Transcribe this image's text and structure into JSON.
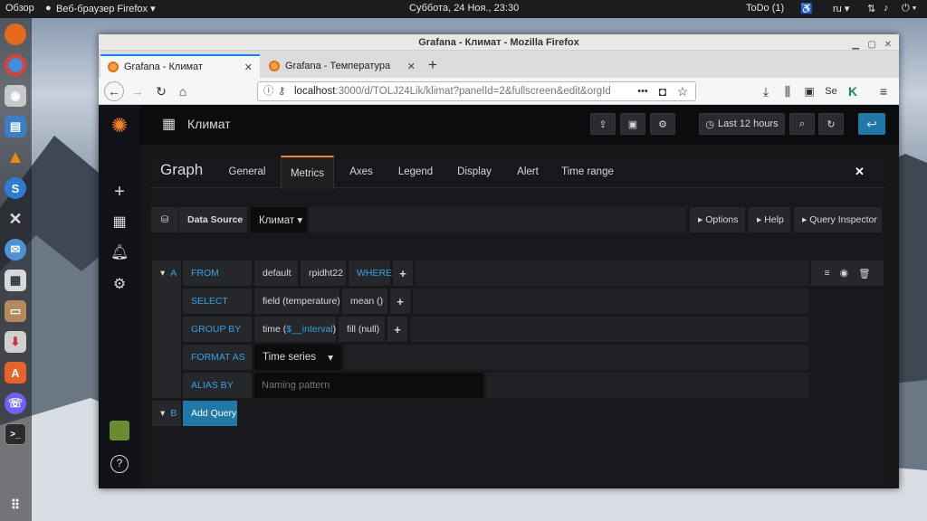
{
  "desktop": {
    "activities": "Обзор",
    "browser_menu": "Веб-браузер Firefox ▾",
    "clock": "Суббота, 24 Ноя., 23:30",
    "todo": "ToDo (1)",
    "lang": "ru ▾",
    "accessibility_icon": "accessibility-icon",
    "network_icon": "network-icon",
    "volume_icon": "volume-icon",
    "power_icon": "power-icon"
  },
  "dock": {
    "items": [
      "firefox",
      "chrome",
      "unknown-app",
      "files",
      "vlc",
      "skype",
      "tools",
      "thunderbird",
      "calculator",
      "drive",
      "install",
      "software",
      "viber",
      "terminal",
      "app-grid"
    ]
  },
  "window": {
    "title": "Grafana - Климат - Mozilla Firefox",
    "tabs": [
      {
        "label": "Grafana - Климат",
        "close": "✕"
      },
      {
        "label": "Grafana - Температура",
        "close": "✕"
      }
    ],
    "new_tab": "+",
    "url_host": "localhost",
    "url_rest": ":3000/d/TOLJ24Lik/klimat?panelId=2&fullscreen&edit&orgId",
    "url_dots": "•••"
  },
  "grafana": {
    "dashboard_title": "Климат",
    "time_range": "Last 12 hours",
    "panel_title": "Graph",
    "editor_tabs": [
      "General",
      "Metrics",
      "Axes",
      "Legend",
      "Display",
      "Alert",
      "Time range"
    ],
    "active_tab": "Metrics",
    "close": "✕",
    "datasource_label": "Data Source",
    "datasource_value": "Климат ▾",
    "options_btn": "▸ Options",
    "help_btn": "▸ Help",
    "inspector_btn": "▸ Query Inspector",
    "query_a": {
      "collapse": "▾",
      "ref": "A",
      "from_label": "FROM",
      "from_policy": "default",
      "from_measurement": "rpidht22",
      "where_label": "WHERE",
      "select_label": "SELECT",
      "select_field": "field (temperature)",
      "select_fn": "mean ()",
      "groupby_label": "GROUP BY",
      "groupby_time_pre": "time (",
      "groupby_time_var": "$__interval",
      "groupby_time_post": ")",
      "groupby_fill": "fill (null)",
      "format_label": "FORMAT AS",
      "format_value": "Time series",
      "format_arrow": "▾",
      "alias_label": "ALIAS BY",
      "alias_placeholder": "Naming pattern",
      "plus": "+"
    },
    "query_b": {
      "collapse": "▾",
      "ref": "B",
      "add_query": "Add Query"
    },
    "colors": {
      "accent": "#f58320",
      "keyword": "#33a2e5",
      "primary": "#1f78a6"
    }
  }
}
